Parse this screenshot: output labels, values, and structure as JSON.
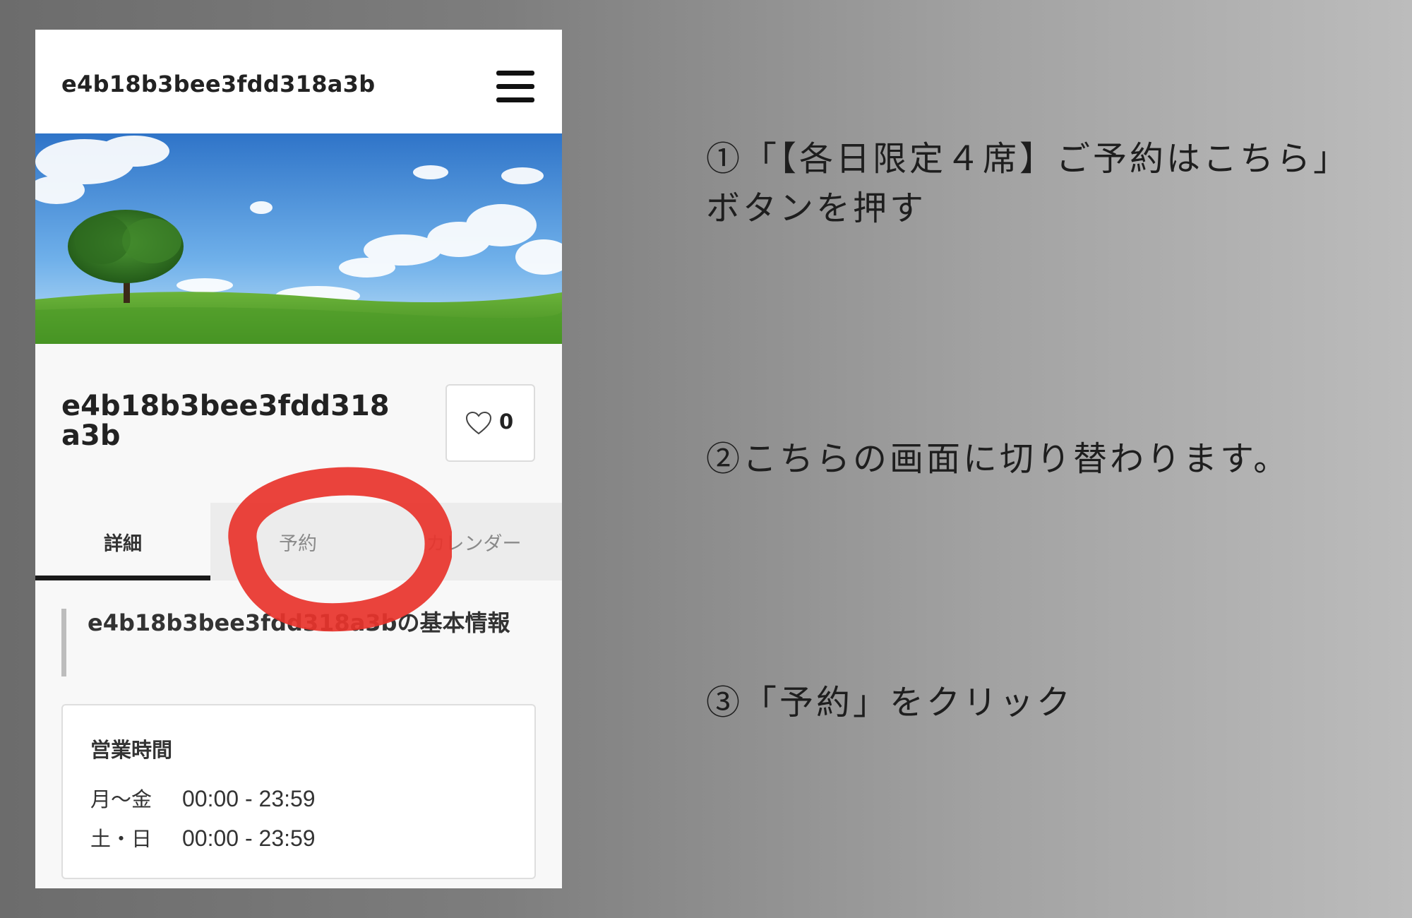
{
  "header": {
    "site_name": "e4b18b3bee3fdd318a3b",
    "menu_icon": "hamburger-menu-icon"
  },
  "shop": {
    "title": "e4b18b3bee3fdd318a3b",
    "like_count": "0",
    "like_icon": "heart-outline-icon"
  },
  "tabs": [
    {
      "label": "詳細",
      "active": true
    },
    {
      "label": "予約",
      "active": false
    },
    {
      "label": "カレンダー",
      "active": false
    }
  ],
  "section": {
    "title": "e4b18b3bee3fdd318a3bの基本情報"
  },
  "hours": {
    "heading": "営業時間",
    "rows": [
      {
        "day": "月〜金",
        "time": "00:00 - 23:59"
      },
      {
        "day": "土・日",
        "time": "00:00 - 23:59"
      }
    ]
  },
  "instructions": {
    "step1": "①「【各日限定４席】ご予約はこちら」ボタンを押す",
    "step2": "②こちらの画面に切り替わります。",
    "step3": "③「予約」をクリック"
  },
  "colors": {
    "highlight_circle": "#e8332b",
    "tab_active_underline": "#1a1a1a"
  }
}
